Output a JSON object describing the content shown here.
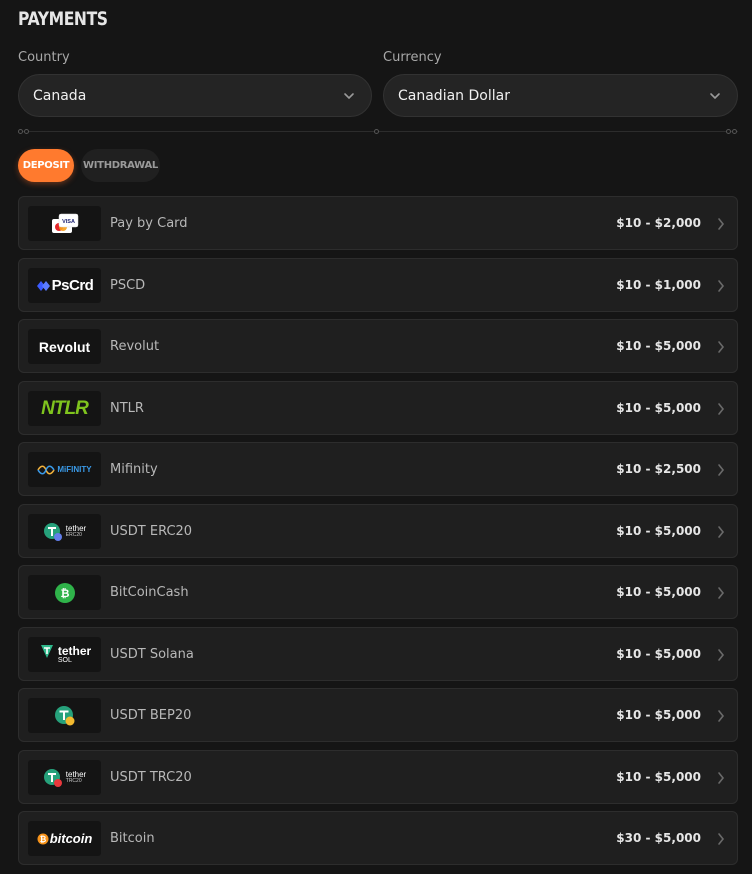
{
  "title": "PAYMENTS",
  "country": {
    "label": "Country",
    "value": "Canada"
  },
  "currency": {
    "label": "Currency",
    "value": "Canadian Dollar"
  },
  "tabs": {
    "deposit": "DEPOSIT",
    "withdrawal": "WITHDRAWAL"
  },
  "logos": {
    "visa": "VISA",
    "pscrd": "PsCrd",
    "revolut": "Revolut",
    "ntlr": "NTLR",
    "mifinity": "MiFINITY",
    "tether": "tether",
    "erc20": "ERC20",
    "sol": "SOL",
    "trc20": "TRC20",
    "bitcoin": "bitcoin"
  },
  "methods": [
    {
      "name": "Pay by Card",
      "limit": "$10 - $2,000",
      "logo": "card-icon"
    },
    {
      "name": "PSCD",
      "limit": "$10 - $1,000",
      "logo": "pscrd-logo"
    },
    {
      "name": "Revolut",
      "limit": "$10 - $5,000",
      "logo": "revolut-logo"
    },
    {
      "name": "NTLR",
      "limit": "$10 - $5,000",
      "logo": "ntlr-logo"
    },
    {
      "name": "Mifinity",
      "limit": "$10 - $2,500",
      "logo": "mifinity-logo"
    },
    {
      "name": "USDT ERC20",
      "limit": "$10 - $5,000",
      "logo": "tether-erc20-logo"
    },
    {
      "name": "BitCoinCash",
      "limit": "$10 - $5,000",
      "logo": "bitcoincash-icon"
    },
    {
      "name": "USDT Solana",
      "limit": "$10 - $5,000",
      "logo": "tether-sol-logo"
    },
    {
      "name": "USDT BEP20",
      "limit": "$10 - $5,000",
      "logo": "tether-bep20-icon"
    },
    {
      "name": "USDT TRC20",
      "limit": "$10 - $5,000",
      "logo": "tether-trc20-logo"
    },
    {
      "name": "Bitcoin",
      "limit": "$30 - $5,000",
      "logo": "bitcoin-logo"
    }
  ]
}
